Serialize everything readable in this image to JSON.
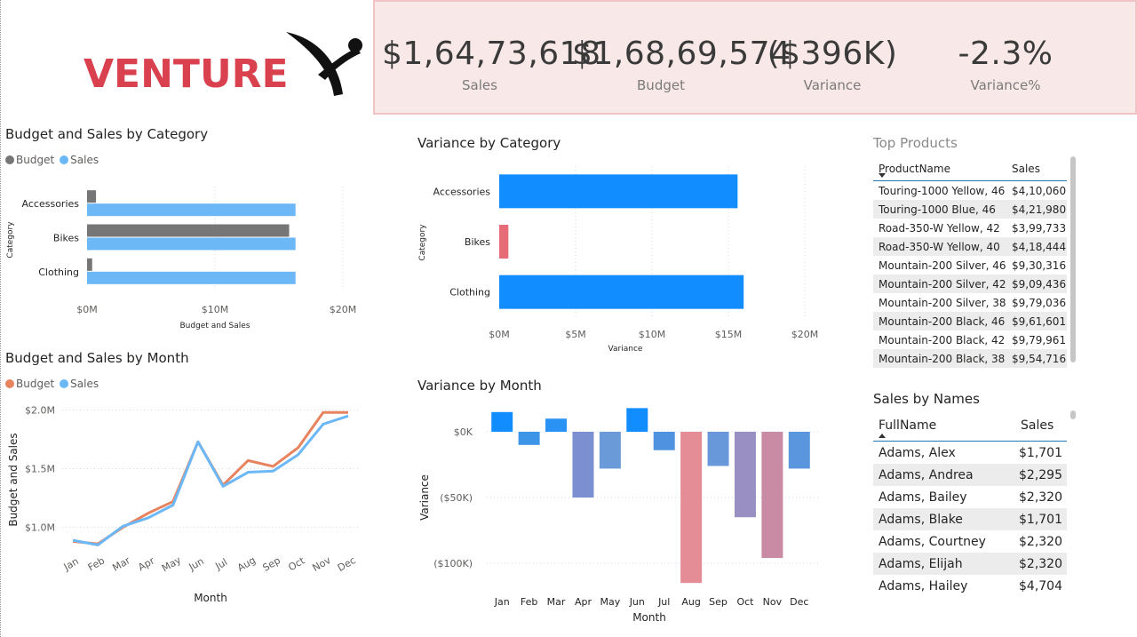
{
  "logo": {
    "text": "VENTURE",
    "color": "#d9414e"
  },
  "kpis": [
    {
      "value": "$1,64,73,618",
      "label": "Sales"
    },
    {
      "value": "$1,68,69,574",
      "label": "Budget"
    },
    {
      "value": "($396K)",
      "label": "Variance"
    },
    {
      "value": "-2.3%",
      "label": "Variance%"
    }
  ],
  "colors": {
    "budget_grey": "#767676",
    "sales_blue": "#6cb8f6",
    "variance_blue": "#118dff",
    "variance_red": "#e66c78",
    "budget_orange": "#e8835f",
    "kpi_bg": "#f9e8e8"
  },
  "budget_sales_by_category": {
    "title": "Budget and Sales by Category",
    "legend": [
      "Budget",
      "Sales"
    ],
    "ylabel": "Category",
    "xlabel": "Budget and Sales",
    "ticks": [
      "$0M",
      "$10M",
      "$20M"
    ]
  },
  "variance_by_category": {
    "title": "Variance by Category",
    "ylabel": "Category",
    "xlabel": "Variance",
    "ticks": [
      "$0M",
      "$5M",
      "$10M",
      "$15M",
      "$20M"
    ]
  },
  "budget_sales_by_month": {
    "title": "Budget and Sales by Month",
    "legend": [
      "Budget",
      "Sales"
    ],
    "ylabel": "Budget and Sales",
    "xlabel": "Month",
    "ticks": [
      "$2.0M",
      "$1.5M",
      "$1.0M"
    ]
  },
  "variance_by_month": {
    "title": "Variance by Month",
    "ylabel": "Variance",
    "xlabel": "Month",
    "ticks": [
      "$0K",
      "($50K)",
      "($100K)"
    ]
  },
  "chart_data": [
    {
      "type": "bar",
      "title": "Budget and Sales by Category",
      "categories": [
        "Accessories",
        "Bikes",
        "Clothing"
      ],
      "series": [
        {
          "name": "Budget",
          "values": [
            0.7,
            15.8,
            0.4
          ]
        },
        {
          "name": "Sales",
          "values": [
            16.3,
            16.3,
            16.3
          ]
        }
      ],
      "xlabel": "Budget and Sales",
      "ylabel": "Category",
      "xlim": [
        0,
        20
      ],
      "unit": "M",
      "legend": "top-left"
    },
    {
      "type": "bar",
      "title": "Variance by Category",
      "categories": [
        "Accessories",
        "Bikes",
        "Clothing"
      ],
      "values": [
        15.6,
        0.6,
        16.0
      ],
      "xlabel": "Variance",
      "ylabel": "Category",
      "xlim": [
        0,
        20
      ],
      "unit": "M"
    },
    {
      "type": "line",
      "title": "Budget and Sales by Month",
      "x": [
        "Jan",
        "Feb",
        "Mar",
        "Apr",
        "May",
        "Jun",
        "Jul",
        "Aug",
        "Sep",
        "Oct",
        "Nov",
        "Dec"
      ],
      "series": [
        {
          "name": "Budget",
          "values": [
            0.88,
            0.86,
            1.0,
            1.12,
            1.22,
            1.73,
            1.36,
            1.57,
            1.52,
            1.68,
            1.98,
            1.98
          ]
        },
        {
          "name": "Sales",
          "values": [
            0.89,
            0.85,
            1.01,
            1.08,
            1.19,
            1.73,
            1.35,
            1.47,
            1.48,
            1.62,
            1.88,
            1.95
          ]
        }
      ],
      "xlabel": "Month",
      "ylabel": "Budget and Sales",
      "ylim": [
        0.8,
        2.05
      ],
      "unit": "M",
      "legend": "top-left"
    },
    {
      "type": "bar",
      "title": "Variance by Month",
      "categories": [
        "Jan",
        "Feb",
        "Mar",
        "Apr",
        "May",
        "Jun",
        "Jul",
        "Aug",
        "Sep",
        "Oct",
        "Nov",
        "Dec"
      ],
      "values": [
        15,
        -10,
        10,
        -50,
        -28,
        18,
        -14,
        -115,
        -26,
        -65,
        -96,
        -28
      ],
      "colors": [
        "#118dff",
        "#3d95e8",
        "#2b92f5",
        "#7c8fd1",
        "#6a9ad8",
        "#118dff",
        "#4f92df",
        "#e48d96",
        "#6998da",
        "#9a8fc3",
        "#c98aa3",
        "#5a96de"
      ],
      "xlabel": "Month",
      "ylabel": "Variance",
      "ylim": [
        -120,
        20
      ],
      "unit": "K"
    }
  ],
  "top_products": {
    "title": "Top Products",
    "columns": [
      "ProductName",
      "Sales"
    ],
    "rows": [
      [
        "Touring-1000 Yellow, 46",
        "$4,10,060"
      ],
      [
        "Touring-1000 Blue, 46",
        "$4,21,980"
      ],
      [
        "Road-350-W Yellow, 42",
        "$3,99,733"
      ],
      [
        "Road-350-W Yellow, 40",
        "$4,18,444"
      ],
      [
        "Mountain-200 Silver, 46",
        "$9,30,316"
      ],
      [
        "Mountain-200 Silver, 42",
        "$9,09,436"
      ],
      [
        "Mountain-200 Silver, 38",
        "$9,79,036"
      ],
      [
        "Mountain-200 Black, 46",
        "$9,61,601"
      ],
      [
        "Mountain-200 Black, 42",
        "$9,79,961"
      ],
      [
        "Mountain-200 Black, 38",
        "$9,54,716"
      ]
    ]
  },
  "sales_by_names": {
    "title": "Sales by Names",
    "columns": [
      "FullName",
      "Sales"
    ],
    "rows": [
      [
        "Adams, Alex",
        "$1,701"
      ],
      [
        "Adams, Andrea",
        "$2,295"
      ],
      [
        "Adams, Bailey",
        "$2,320"
      ],
      [
        "Adams, Blake",
        "$1,701"
      ],
      [
        "Adams, Courtney",
        "$2,320"
      ],
      [
        "Adams, Elijah",
        "$2,320"
      ],
      [
        "Adams, Hailey",
        "$4,704"
      ]
    ]
  }
}
